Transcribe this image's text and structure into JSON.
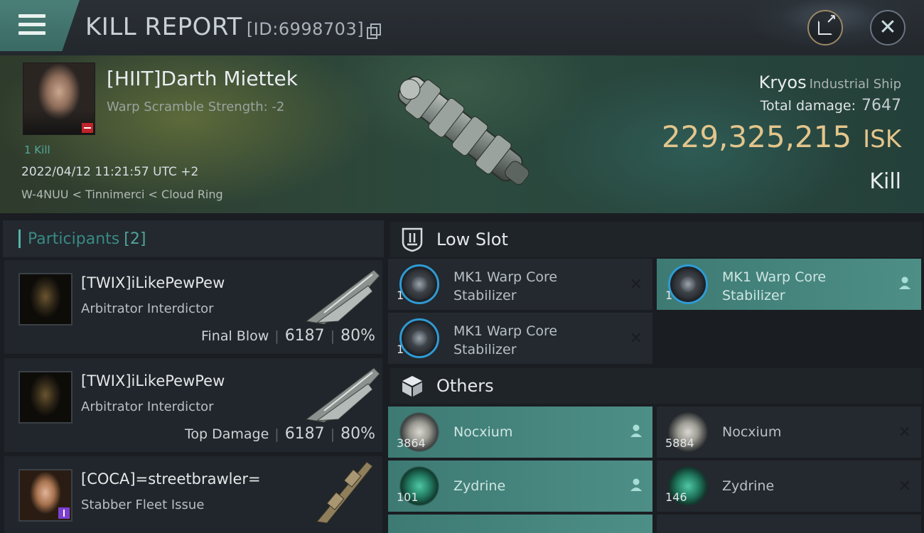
{
  "header": {
    "title": "KILL REPORT",
    "id_text": "[ID:6998703]"
  },
  "victim": {
    "pilot_name": "[HIIT]Darth Miettek",
    "warp_scramble": "Warp Scramble Strength: -2",
    "kill_count": "1 Kill",
    "datetime": "2022/04/12 11:21:57 UTC +2",
    "location": "W-4NUU < Tinnimerci < Cloud Ring",
    "ship": "Kryos",
    "ship_class": "Industrial Ship",
    "total_damage_label": "Total damage:",
    "total_damage": "7647",
    "isk_value": "229,325,215",
    "isk_unit": "ISK",
    "result": "Kill"
  },
  "participants": {
    "title": "Participants",
    "count": "[2]",
    "items": [
      {
        "name": "[TWIX]iLikePewPew",
        "ship": "Arbitrator Interdictor",
        "role": "Final Blow",
        "damage": "6187",
        "percent": "80%"
      },
      {
        "name": "[TWIX]iLikePewPew",
        "ship": "Arbitrator Interdictor",
        "role": "Top Damage",
        "damage": "6187",
        "percent": "80%"
      },
      {
        "name": "[COCA]=streetbrawler=",
        "ship": "Stabber Fleet Issue"
      }
    ]
  },
  "low_slot": {
    "title": "Low Slot",
    "items": [
      {
        "qty": "1",
        "name_line1": "MK1 Warp Core",
        "name_line2": "Stabilizer",
        "status": "destroyed"
      },
      {
        "qty": "1",
        "name_line1": "MK1 Warp Core",
        "name_line2": "Stabilizer",
        "status": "dropped"
      },
      {
        "qty": "1",
        "name_line1": "MK1 Warp Core",
        "name_line2": "Stabilizer",
        "status": "destroyed"
      }
    ]
  },
  "others": {
    "title": "Others",
    "items": [
      {
        "qty": "3864",
        "name": "Nocxium",
        "status": "dropped"
      },
      {
        "qty": "5884",
        "name": "Nocxium",
        "status": "destroyed"
      },
      {
        "qty": "101",
        "name": "Zydrine",
        "status": "dropped"
      },
      {
        "qty": "146",
        "name": "Zydrine",
        "status": "destroyed"
      }
    ]
  },
  "colors": {
    "accent_teal": "#4d8f87",
    "isk_gold": "#e2c58c",
    "corp_red": "#c0232b",
    "rank_purple": "#7b3fd0"
  },
  "icons": {
    "menu": "hamburger-icon",
    "copy": "copy-icon",
    "share": "share-icon",
    "close": "close-icon",
    "low_slot": "low-slot-icon",
    "others": "cube-icon",
    "destroyed": "cross-icon",
    "dropped": "person-icon"
  }
}
